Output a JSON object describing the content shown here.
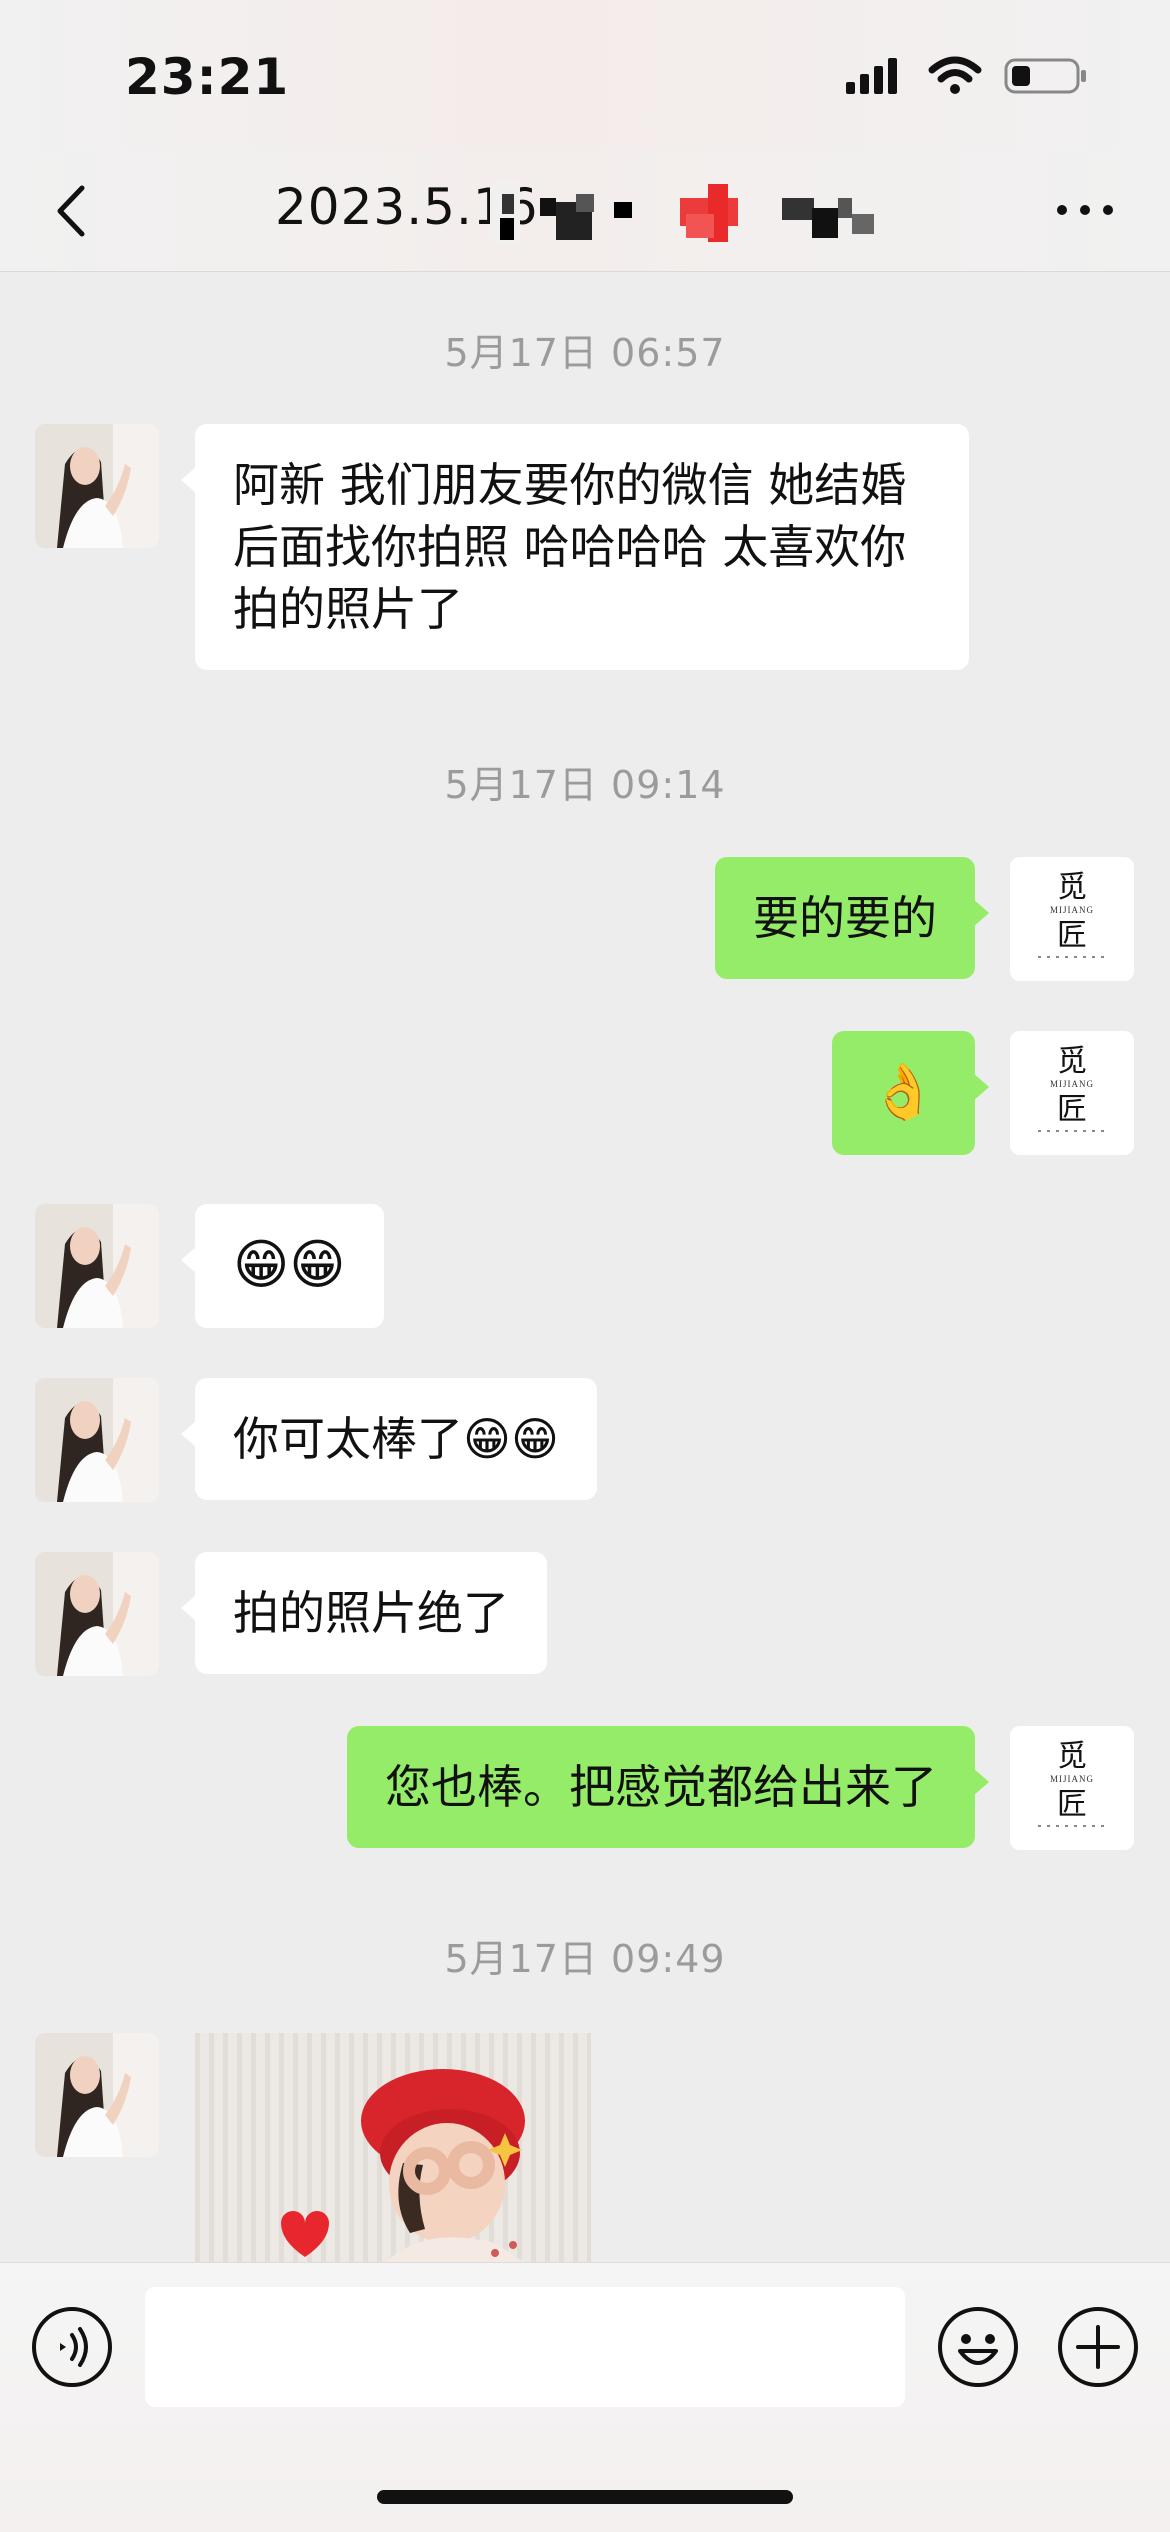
{
  "status_bar": {
    "time": "23:21"
  },
  "header": {
    "title": "2023.5.16"
  },
  "messages": [
    {
      "side": "left",
      "type": "timestamp",
      "text": "5月17日 06:57"
    },
    {
      "side": "left",
      "type": "text",
      "text": "阿新 我们朋友要你的微信 她结婚后面找你拍照 哈哈哈哈 太喜欢你拍的照片了"
    },
    {
      "type": "timestamp",
      "text": "5月17日 09:14"
    },
    {
      "side": "right",
      "type": "text",
      "text": "要的要的"
    },
    {
      "side": "right",
      "type": "emoji",
      "text": "👌"
    },
    {
      "side": "left",
      "type": "emoji",
      "text": "😁😁"
    },
    {
      "side": "left",
      "type": "text",
      "text": "你可太棒了😁😁"
    },
    {
      "side": "left",
      "type": "text",
      "text": "拍的照片绝了"
    },
    {
      "side": "right",
      "type": "text",
      "text": "您也棒。把感觉都给出来了"
    },
    {
      "type": "timestamp",
      "text": "5月17日 09:49"
    },
    {
      "side": "left",
      "type": "image",
      "text": ""
    }
  ],
  "brand_avatar": {
    "line1": "觅",
    "sub": "MIJIANG",
    "line2": "匠"
  },
  "icons": {
    "back": "chevron-left-icon",
    "more": "more-dots-icon",
    "voice": "voice-icon",
    "emoji": "smile-icon",
    "add": "plus-icon"
  },
  "colors": {
    "sent_bubble": "#95ec69",
    "received_bubble": "#ffffff",
    "background": "#ededed"
  }
}
